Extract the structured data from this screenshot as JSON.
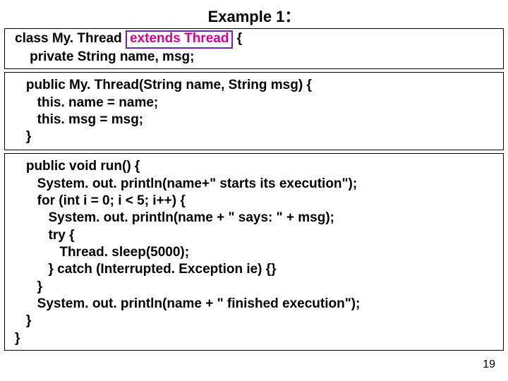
{
  "title": "Example 1：",
  "page_number": "19",
  "box1": {
    "l1_a": "class My. Thread ",
    "l1_hl": "extends Thread",
    "l1_b": " {",
    "l2": "    private String name, msg;"
  },
  "box2": {
    "l1": "   public My. Thread(String name, String msg) {",
    "l2": "      this. name = name;",
    "l3": "      this. msg = msg;",
    "l4": "   }"
  },
  "box3": {
    "l1": "   public void run() {",
    "l2": "      System. out. println(name+\" starts its execution\");",
    "l3": "      for (int i = 0; i < 5; i++) {",
    "l4": "         System. out. println(name + \" says: \" + msg);",
    "l5": "         try {",
    "l6": "            Thread. sleep(5000);",
    "l7": "         } catch (Interrupted. Exception ie) {}",
    "l8": "      }",
    "l9": "      System. out. println(name + \" finished execution\");",
    "l10": "   }",
    "l11": "}"
  }
}
